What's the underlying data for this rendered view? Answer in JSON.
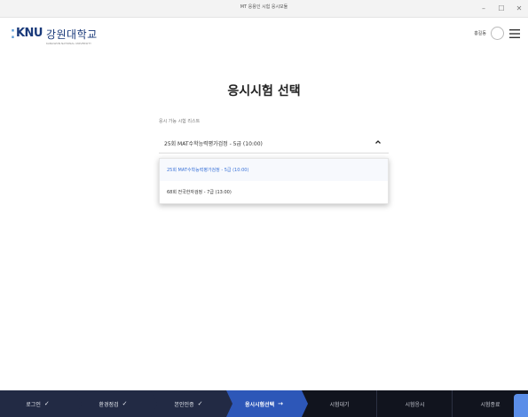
{
  "window": {
    "title": "MT 응용인 시험 응시모듈",
    "controls": [
      "–",
      "☐",
      "✕"
    ]
  },
  "header": {
    "logo_mark": "⁚",
    "logo_text": "KNU",
    "logo_kr": "강원대학교",
    "logo_en": "KANGWON NATIONAL UNIVERSITY",
    "user_name": "홍길동",
    "avatar_icon": "user-avatar-icon",
    "menu_icon": "hamburger-menu-icon"
  },
  "main": {
    "title": "응시시험 선택",
    "list_caption": "응시 가능 시험 리스트",
    "select": {
      "value": "25회 MAT수학능력평가검정 - 5급 (10:00)",
      "icon": "chevron-up-icon",
      "options": [
        {
          "label": "25회 MAT수학능력평가검정 - 5급 (10:00)",
          "selected": true
        },
        {
          "label": "68회 전국한자검정 - 7급 (13:00)",
          "selected": false
        }
      ]
    }
  },
  "steps": [
    {
      "label": "로그인",
      "state": "done",
      "marker": "✓"
    },
    {
      "label": "환경점검",
      "state": "done",
      "marker": "✓"
    },
    {
      "label": "본인인증",
      "state": "done",
      "marker": "✓"
    },
    {
      "label": "응시시험선택",
      "state": "active",
      "marker": "→"
    },
    {
      "label": "시험대기",
      "state": "pending",
      "marker": ""
    },
    {
      "label": "시험응시",
      "state": "pending",
      "marker": ""
    },
    {
      "label": "시험종료",
      "state": "pending",
      "marker": ""
    }
  ],
  "colors": {
    "accent": "#2d57b8",
    "selected_option": "#3b73d8",
    "stepbar": "#1c2133",
    "fab": "#5b8ee8"
  }
}
